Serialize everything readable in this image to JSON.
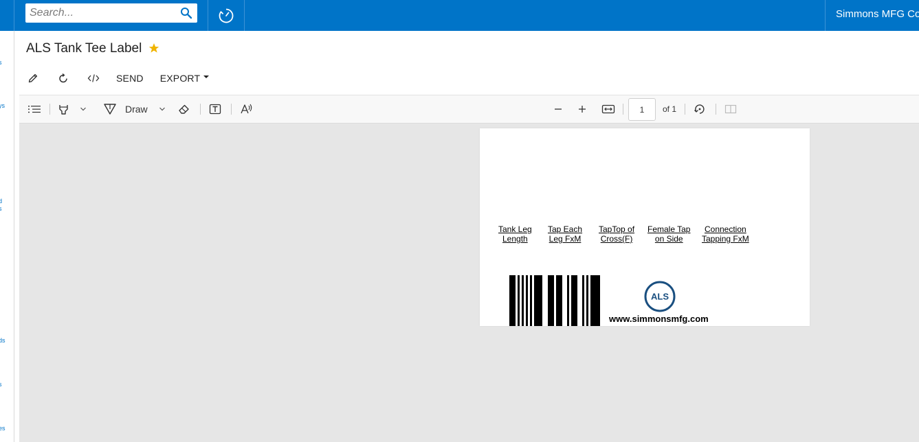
{
  "header": {
    "search_placeholder": "Search...",
    "company": "Simmons MFG Co"
  },
  "leftnav": {
    "fragments": [
      "s",
      "ys",
      "d",
      "s",
      "ds",
      "s",
      "es"
    ]
  },
  "page": {
    "title": "ALS Tank Tee Label",
    "favorite": true
  },
  "actions": {
    "send": "SEND",
    "export": "EXPORT"
  },
  "viewer_toolbar": {
    "draw": "Draw",
    "page_number": "1",
    "page_total": "of 1"
  },
  "label": {
    "columns": [
      {
        "line1": "Tank Leg",
        "line2": "Length"
      },
      {
        "line1": "Tap Each",
        "line2": "Leg FxM"
      },
      {
        "line1": "TapTop of",
        "line2": "Cross(F)"
      },
      {
        "line1": "Female Tap",
        "line2": "on Side"
      },
      {
        "line1": "Connection",
        "line2": "Tapping FxM"
      }
    ],
    "logo_text": "ALS",
    "website": "www.simmonsmfg.com"
  },
  "colors": {
    "accent": "#0074c8",
    "star": "#f0b400",
    "viewer_bg": "#e6e6e6"
  }
}
